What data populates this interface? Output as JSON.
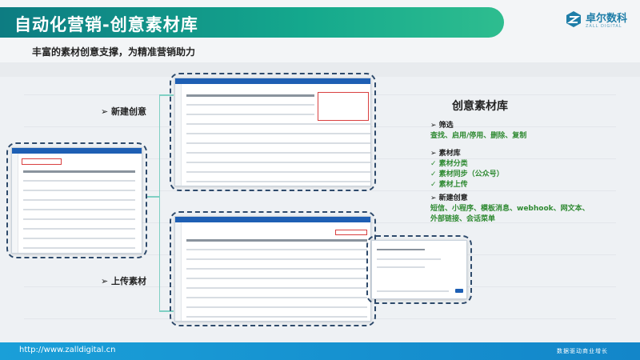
{
  "header": {
    "title": "自动化营销-创意素材库"
  },
  "logo": {
    "name": "卓尔数科",
    "sub": "ZALL DIGITAL"
  },
  "subtitle": "丰富的素材创意支撑，为精准营销助力",
  "labels": {
    "create": "➢ 新建创意",
    "upload": "➢ 上传素材"
  },
  "panel": {
    "title": "创意素材库",
    "groups": [
      {
        "heading": "➢ 筛选",
        "items": [
          "查找、启用/停用、删除、复制"
        ]
      },
      {
        "heading": "➢ 素材库",
        "items": [
          "✓ 素材分类",
          "✓ 素材同步（公众号）",
          "✓ 素材上传"
        ]
      },
      {
        "heading": "➢ 新建创意",
        "items": [
          "短信、小程序、模板消息、webhook、网文本、",
          "外部链接、会话菜单"
        ]
      }
    ]
  },
  "footer": {
    "url": "http://www.zalldigital.cn",
    "slogan": "数据驱动商业增长"
  },
  "colors": {
    "accent": "#14a88d",
    "dash": "#2e4a6b",
    "footer": "#1a9fd8",
    "green_text": "#2f8a32"
  }
}
